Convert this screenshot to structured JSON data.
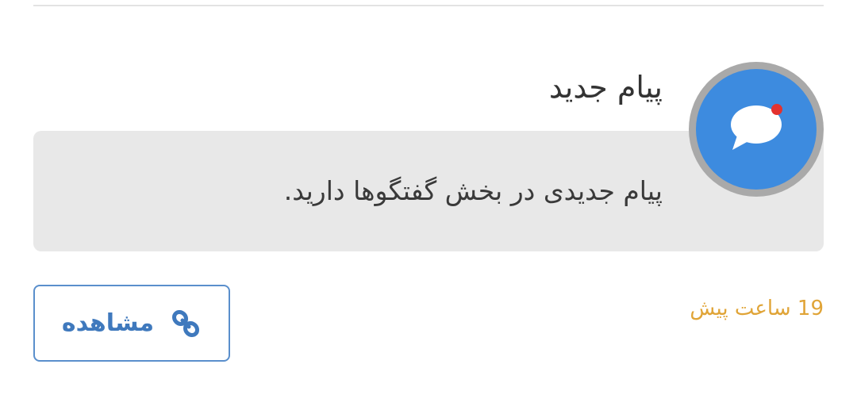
{
  "notification": {
    "title": "پیام جدید",
    "body": "پیام جدیدی در بخش گفتگوها دارید.",
    "time": "19 ساعت پیش",
    "view_label": "مشاهده",
    "icons": {
      "avatar": "chat-bubble-icon",
      "button": "link-icon"
    },
    "colors": {
      "avatar_bg": "#3d8bdf",
      "unread_dot": "#e3322f",
      "time": "#e0a437",
      "button_border": "#5a8fcc",
      "box_bg": "#e8e8e8"
    }
  }
}
